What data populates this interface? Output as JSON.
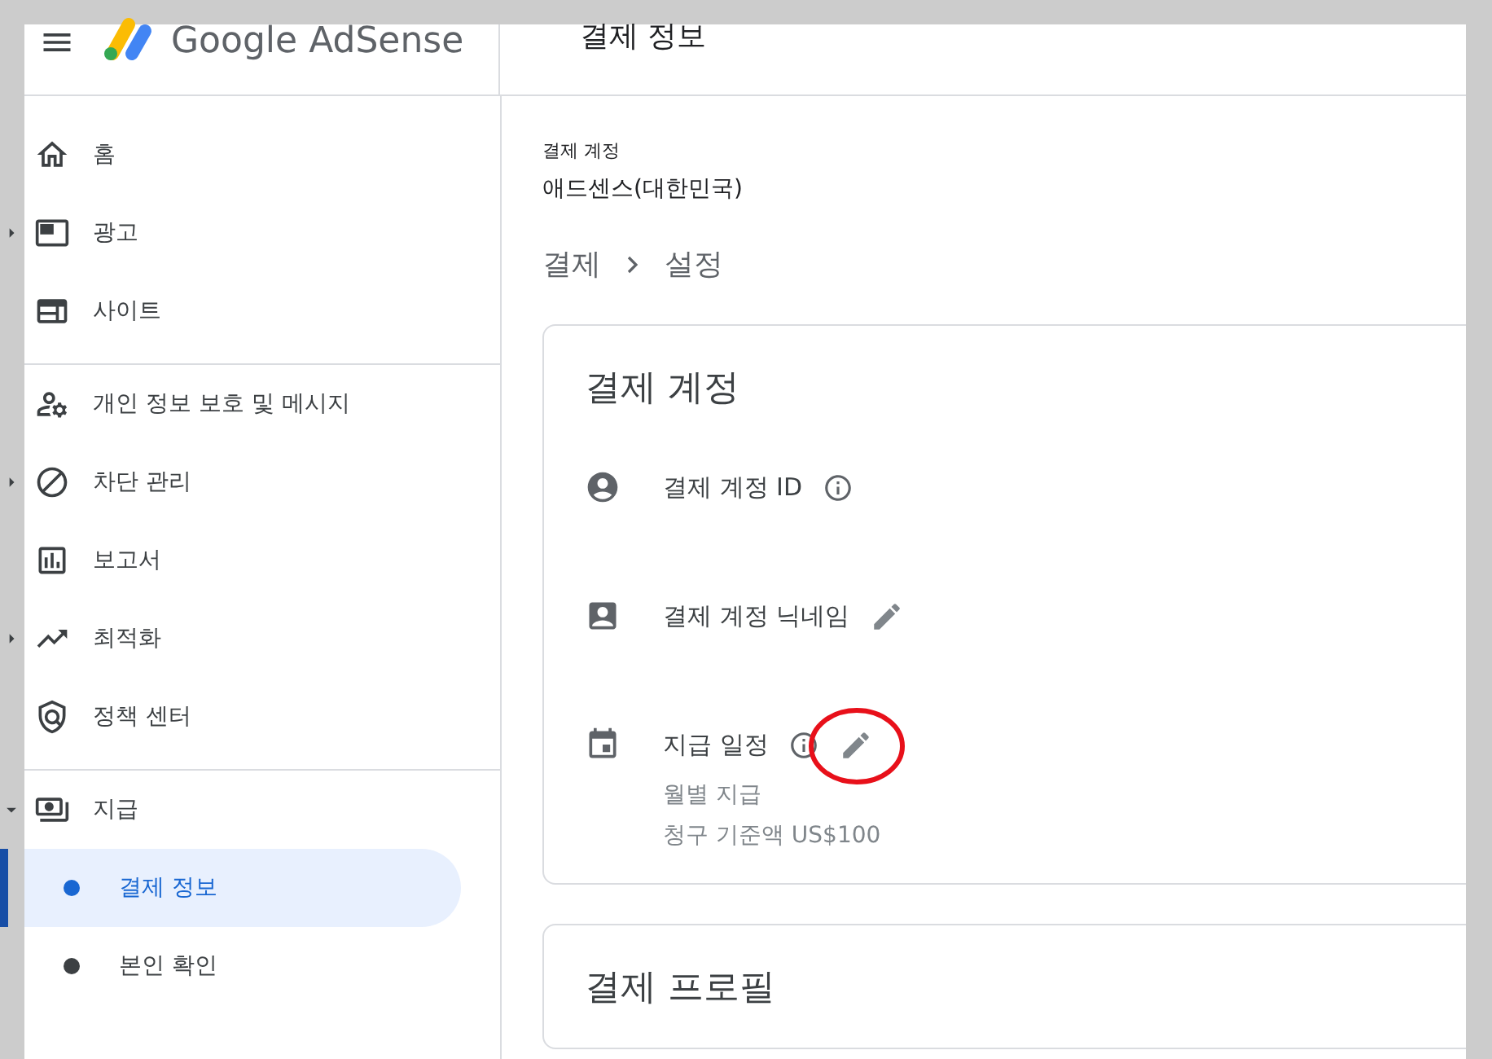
{
  "header": {
    "product": "Google AdSense",
    "page_title": "결제 정보"
  },
  "sidebar": {
    "sections": [
      {
        "items": [
          {
            "label": "홈",
            "selected": false
          },
          {
            "label": "광고",
            "selected": false,
            "expanded": false
          },
          {
            "label": "사이트",
            "selected": false
          }
        ]
      },
      {
        "items": [
          {
            "label": "개인 정보 보호 및 메시지",
            "selected": false
          },
          {
            "label": "차단 관리",
            "selected": false,
            "expanded": false
          },
          {
            "label": "보고서",
            "selected": false
          },
          {
            "label": "최적화",
            "selected": false,
            "expanded": false
          },
          {
            "label": "정책 센터",
            "selected": false
          }
        ]
      },
      {
        "items": [
          {
            "label": "지급",
            "selected": false,
            "expanded": true,
            "children": [
              {
                "label": "결제 정보",
                "selected": true
              },
              {
                "label": "본인 확인",
                "selected": false
              }
            ]
          }
        ]
      }
    ]
  },
  "main": {
    "account_label": "결제 계정",
    "account_name": "애드센스(대한민국)",
    "breadcrumb": [
      "결제",
      "설정"
    ],
    "cards": [
      {
        "title": "결제 계정",
        "rows": [
          {
            "label": "결제 계정 ID",
            "info": true,
            "edit": false,
            "circled": false
          },
          {
            "label": "결제 계정 닉네임",
            "info": false,
            "edit": true,
            "circled": false
          },
          {
            "label": "지급 일정",
            "info": true,
            "edit": true,
            "circled": true,
            "details": [
              "월별 지급",
              "청구 기준액 US$100"
            ]
          }
        ]
      },
      {
        "title": "결제 프로필"
      }
    ]
  }
}
